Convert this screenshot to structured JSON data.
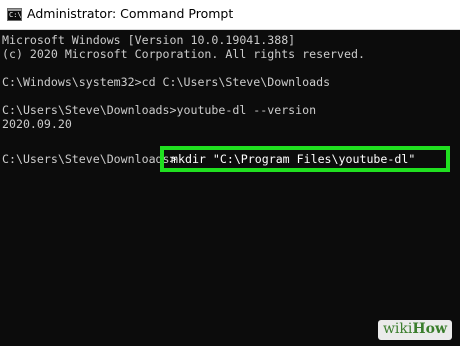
{
  "window": {
    "title": "Administrator: Command Prompt",
    "icon": "console-icon",
    "icon_glyph": "C:\\"
  },
  "console": {
    "lines": [
      "Microsoft Windows [Version 10.0.19041.388]",
      "(c) 2020 Microsoft Corporation. All rights reserved.",
      "",
      "C:\\Windows\\system32>cd C:\\Users\\Steve\\Downloads",
      "",
      "C:\\Users\\Steve\\Downloads>youtube-dl --version",
      "2020.09.20",
      "",
      "C:\\Users\\Steve\\Downloads>"
    ],
    "highlighted_command": "mkdir \"C:\\Program Files\\youtube-dl\"",
    "highlight_color": "#20e020",
    "text_color": "#cccccc",
    "background_color": "#0c0c0c"
  },
  "watermark": {
    "part1": "wiki",
    "part2": "How"
  }
}
